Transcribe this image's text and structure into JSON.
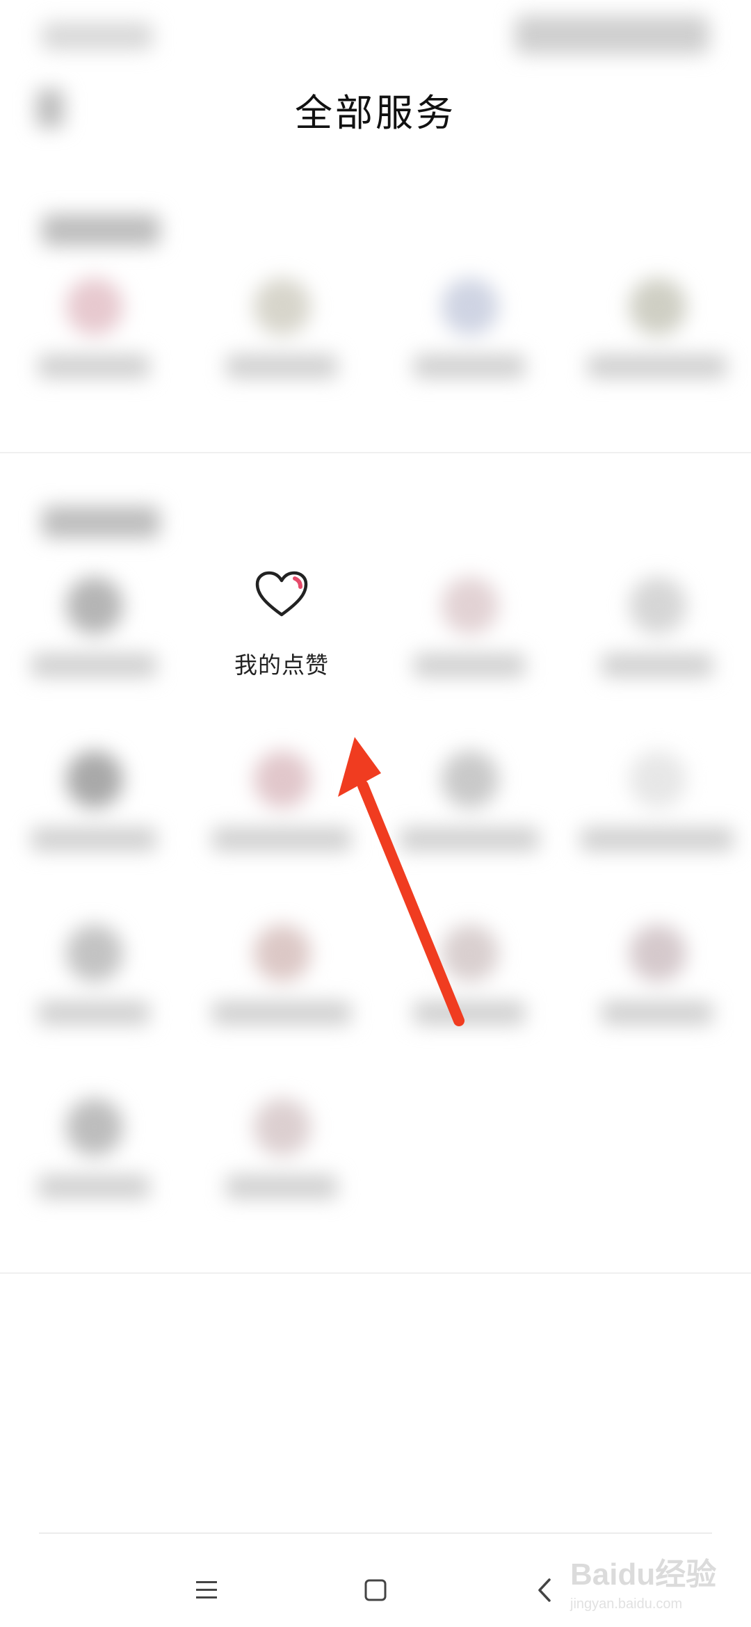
{
  "header": {
    "title": "全部服务"
  },
  "featured_item": {
    "label": "我的点赞",
    "icon": "heart-icon"
  },
  "navbar": {
    "menu_icon": "menu-icon",
    "home_icon": "home-square-icon",
    "back_icon": "back-chevron-icon"
  },
  "watermark": {
    "text": "Baidu经验",
    "url": "jingyan.baidu.com"
  },
  "colors": {
    "arrow": "#f03c20",
    "heart_accent": "#e64a6a"
  }
}
